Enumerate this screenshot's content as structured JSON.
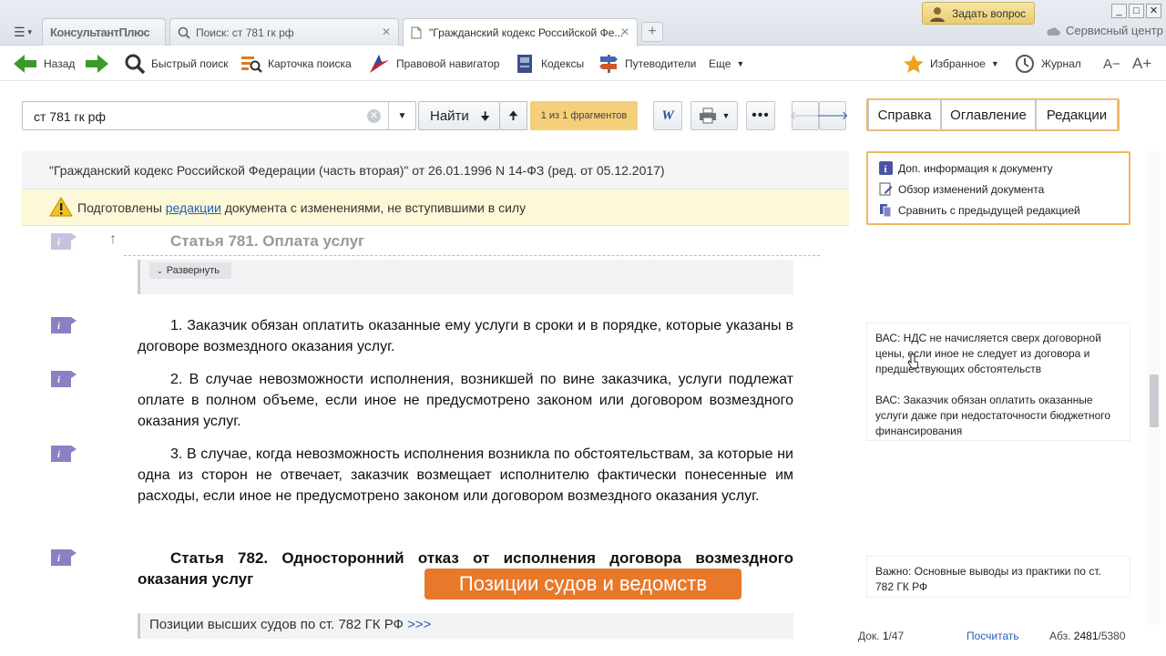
{
  "tabs": [
    {
      "label": "КонсультантПлюс"
    },
    {
      "label": "Поиск: ст 781 гк рф"
    },
    {
      "label": "\"Гражданский кодекс Российской Фе..."
    }
  ],
  "header": {
    "ask_question": "Задать вопрос",
    "service_center": "Сервисный центр"
  },
  "toolbar": {
    "back": "Назад",
    "quick_search": "Быстрый поиск",
    "search_card": "Карточка поиска",
    "legal_navigator": "Правовой навигатор",
    "codes": "Кодексы",
    "guides": "Путеводители",
    "more": "Еще",
    "favorites": "Избранное",
    "journal": "Журнал",
    "font_smaller": "A−",
    "font_larger": "A+"
  },
  "search": {
    "value": "ст 781 гк рф",
    "find_label": "Найти",
    "fragments": "1 из 1 фрагментов"
  },
  "right_tabs": [
    "Справка",
    "Оглавление",
    "Редакции"
  ],
  "document": {
    "title": "\"Гражданский кодекс Российской Федерации (часть вторая)\" от 26.01.1996 N 14-ФЗ (ред. от 05.12.2017)",
    "notice_pre": "Подготовлены ",
    "notice_link": "редакции",
    "notice_post": " документа с изменениями, не вступившими в силу",
    "article_781": "Статья 781. Оплата услуг",
    "expand": "Развернуть",
    "p1": "1. Заказчик обязан оплатить оказанные ему услуги в сроки и в порядке, которые указаны в договоре возмездного оказания услуг.",
    "p2": "2. В случае невозможности исполнения, возникшей по вине заказчика, услуги подлежат оплате в полном объеме, если иное не предусмотрено законом или договором возмездного оказания услуг.",
    "p3": "3. В случае, когда невозможность исполнения возникла по обстоятельствам, за которые ни одна из сторон не отвечает, заказчик возмещает исполнителю фактически понесенные им расходы, если иное не предусмотрено законом или договором возмездного оказания услуг.",
    "article_782": "Статья 782. Односторонний отказ от исполнения договора возмездного оказания услуг",
    "overlay_label": "Позиции судов и ведомств",
    "positions_link": "Позиции высших судов по ст. 782 ГК РФ ",
    "positions_more": ">>>"
  },
  "info_panel": [
    "Доп. информация к документу",
    "Обзор изменений документа",
    "Сравнить с предыдущей редакцией"
  ],
  "cards": {
    "vas1": "ВАС: НДС не начисляется сверх договорной цены, если иное не следует из договора и предшествующих обстоятельств",
    "vas2": "ВАС: Заказчик обязан оплатить оказанные услуги даже при недостаточности бюджетного финансирования",
    "important": "Важно: Основные выводы из практики по ст. 782 ГК РФ"
  },
  "status": {
    "doc_label": "Док. ",
    "doc_current": "1",
    "doc_total": "/47",
    "count_link": "Посчитать",
    "abz_label": "Абз. ",
    "abz_current": "2481",
    "abz_total": "/5380"
  },
  "colors": {
    "accent_orange": "#e8782a",
    "frame_orange": "#f0b85a",
    "link_blue": "#1f5fb5",
    "green_arrow": "#3a9a2a"
  }
}
